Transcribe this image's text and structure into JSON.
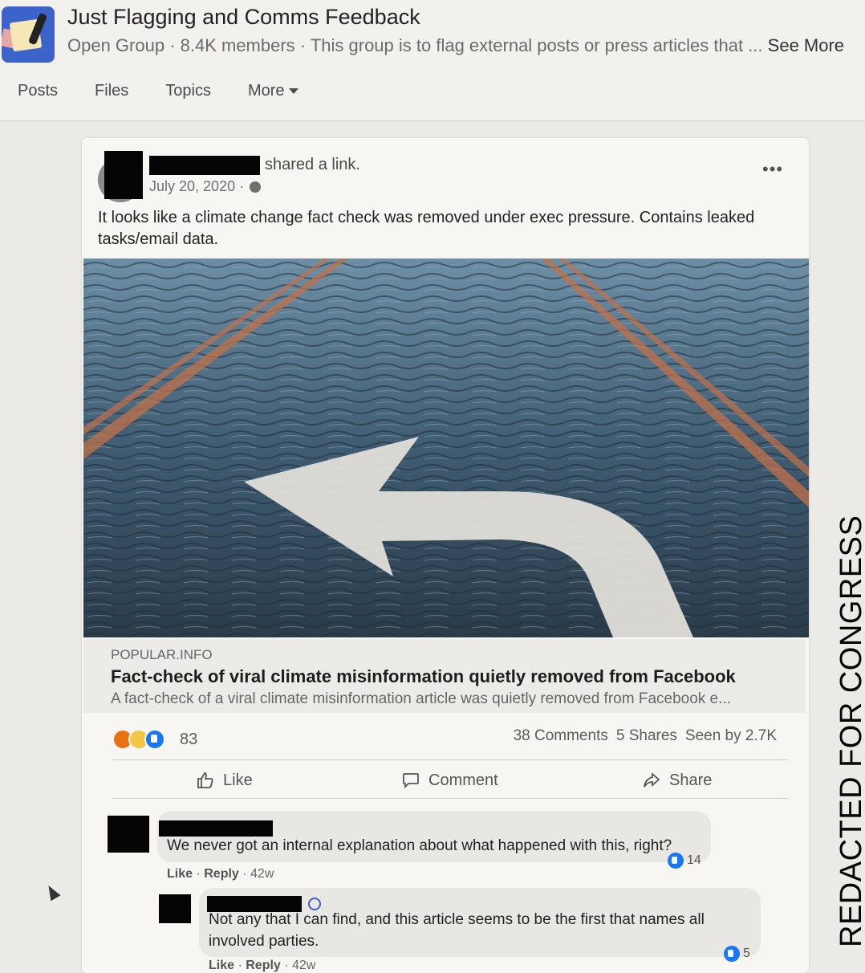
{
  "group": {
    "title": "Just Flagging and Comms Feedback",
    "subtitle": "Open Group · 8.4K members · This group is to flag external posts or press articles that ...",
    "see_more": "See More"
  },
  "tabs": [
    "Posts",
    "Files",
    "Topics",
    "More"
  ],
  "post": {
    "action_text": "shared a link.",
    "date": "July 20, 2020 ·",
    "more_label": "•••",
    "text": "It looks like a climate change fact check was removed under exec pressure. Contains leaked tasks/email data.",
    "link": {
      "domain": "POPULAR.INFO",
      "title": "Fact-check of viral climate misinformation quietly removed from Facebook",
      "description": "A fact-check of a viral climate misinformation article was quietly removed from Facebook e..."
    },
    "reaction_count": "83",
    "comments_count": "38 Comments",
    "shares_count": "5 Shares",
    "seen_by": "Seen by 2.7K",
    "actions": {
      "like": "Like",
      "comment": "Comment",
      "share": "Share"
    }
  },
  "comments": [
    {
      "text": "We never got an internal explanation about what happened with this, right?",
      "like_label": "Like",
      "reply_label": "Reply",
      "age": "42w",
      "likes": "14"
    },
    {
      "text": "Not any that I can find, and this article seems to be the first that names all involved parties.",
      "like_label": "Like",
      "reply_label": "Reply",
      "age": "42w",
      "likes": "5"
    }
  ],
  "watermark": "REDACTED FOR CONGRESS",
  "colors": {
    "facebook_blue": "#1877f2",
    "redaction": "#050505"
  }
}
